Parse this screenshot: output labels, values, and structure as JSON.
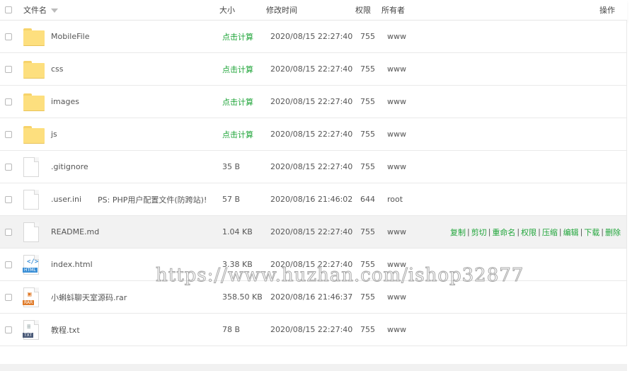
{
  "header": {
    "name": "文件名",
    "size": "大小",
    "mtime": "修改时间",
    "perm": "权限",
    "owner": "所有者",
    "ops": "操作"
  },
  "rows": [
    {
      "type": "folder",
      "name": "MobileFile",
      "note": "",
      "size": "点击计算",
      "size_link": true,
      "mtime": "2020/08/15 22:27:40",
      "perm": "755",
      "owner": "www"
    },
    {
      "type": "folder",
      "name": "css",
      "note": "",
      "size": "点击计算",
      "size_link": true,
      "mtime": "2020/08/15 22:27:40",
      "perm": "755",
      "owner": "www"
    },
    {
      "type": "folder",
      "name": "images",
      "note": "",
      "size": "点击计算",
      "size_link": true,
      "mtime": "2020/08/15 22:27:40",
      "perm": "755",
      "owner": "www"
    },
    {
      "type": "folder",
      "name": "js",
      "note": "",
      "size": "点击计算",
      "size_link": true,
      "mtime": "2020/08/15 22:27:40",
      "perm": "755",
      "owner": "www"
    },
    {
      "type": "file",
      "name": ".gitignore",
      "note": "",
      "size": "35 B",
      "size_link": false,
      "mtime": "2020/08/15 22:27:40",
      "perm": "755",
      "owner": "www"
    },
    {
      "type": "file",
      "name": ".user.ini",
      "note": "PS: PHP用户配置文件(防跨站)!",
      "size": "57 B",
      "size_link": false,
      "mtime": "2020/08/16 21:46:02",
      "perm": "644",
      "owner": "root"
    },
    {
      "type": "file",
      "name": "README.md",
      "note": "",
      "size": "1.04 KB",
      "size_link": false,
      "mtime": "2020/08/15 22:27:40",
      "perm": "755",
      "owner": "www",
      "highlight": true
    },
    {
      "type": "html",
      "name": "index.html",
      "note": "",
      "size": "3.38 KB",
      "size_link": false,
      "mtime": "2020/08/15 22:27:40",
      "perm": "755",
      "owner": "www"
    },
    {
      "type": "rar",
      "name": "小蝌蚪聊天室源码.rar",
      "note": "",
      "size": "358.50 KB",
      "size_link": false,
      "mtime": "2020/08/16 21:46:37",
      "perm": "755",
      "owner": "www"
    },
    {
      "type": "txt",
      "name": "教程.txt",
      "note": "",
      "size": "78 B",
      "size_link": false,
      "mtime": "2020/08/15 22:27:40",
      "perm": "755",
      "owner": "www"
    }
  ],
  "row_actions": [
    "复制",
    "剪切",
    "重命名",
    "权限",
    "压缩",
    "编辑",
    "下载",
    "删除"
  ],
  "icon_labels": {
    "html": "HTML",
    "rar": "RAR",
    "txt": "TXT"
  },
  "watermark": "https://www.huzhan.com/ishop32877",
  "colors": {
    "accent": "#20a53a",
    "folder": "#fddf7e",
    "row_hover": "#f2f2f2"
  }
}
